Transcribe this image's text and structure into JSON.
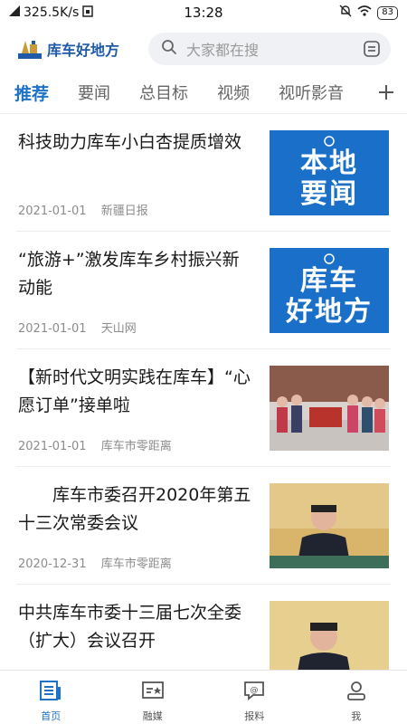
{
  "status_bar": {
    "speed": "325.5K/s",
    "time": "13:28",
    "battery": "83"
  },
  "header": {
    "logo_text": "库车好地方",
    "search_placeholder": "大家都在搜"
  },
  "tabs": [
    {
      "label": "推荐",
      "active": true
    },
    {
      "label": "要闻",
      "active": false
    },
    {
      "label": "总目标",
      "active": false
    },
    {
      "label": "视频",
      "active": false
    },
    {
      "label": "视听影音",
      "active": false
    }
  ],
  "news": [
    {
      "title": "科技助力库车小白杏提质增效",
      "date": "2021-01-01",
      "source": "新疆日报",
      "thumb_lines": [
        "本地",
        "要闻"
      ]
    },
    {
      "title": "“旅游+”激发库车乡村振兴新动能",
      "date": "2021-01-01",
      "source": "天山网",
      "thumb_lines": [
        "库车",
        "好地方"
      ]
    },
    {
      "title": "【新时代文明实践在库车】“心愿订单”接单啦",
      "date": "2021-01-01",
      "source": "库车市零距离",
      "thumb_lines": []
    },
    {
      "title": "　　库车市委召开2020年第五十三次常委会议",
      "date": "2020-12-31",
      "source": "库车市零距离",
      "thumb_lines": []
    },
    {
      "title": "中共库车市委十三届七次全委（扩大）会议召开",
      "date": "",
      "source": "",
      "thumb_lines": []
    }
  ],
  "bottom_nav": [
    {
      "label": "首页",
      "icon": "home-news-icon",
      "active": true
    },
    {
      "label": "融媒",
      "icon": "media-card-icon",
      "active": false
    },
    {
      "label": "报料",
      "icon": "report-chat-icon",
      "active": false
    },
    {
      "label": "我",
      "icon": "user-icon",
      "active": false
    }
  ],
  "colors": {
    "accent": "#1e73c8",
    "thumb_blue": "#1a6fc8"
  }
}
